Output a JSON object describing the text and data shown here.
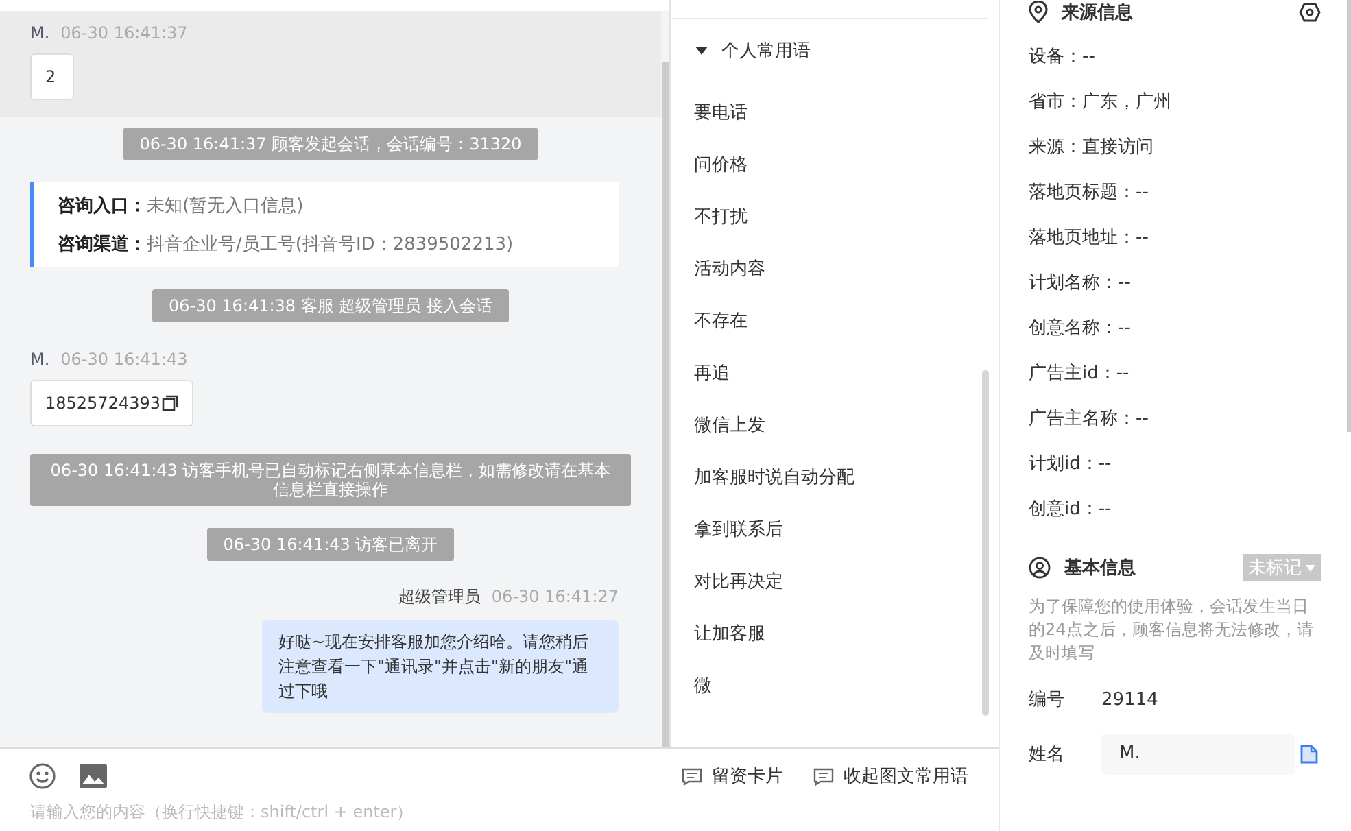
{
  "chat": {
    "messages": [
      {
        "kind": "customer",
        "name": "M.",
        "time": "06-30 16:41:37",
        "text": "2",
        "highlighted": true,
        "copyable": false
      },
      {
        "kind": "system",
        "text": "06-30 16:41:37 顾客发起会话，会话编号：31320"
      },
      {
        "kind": "info",
        "lines": [
          {
            "label": "咨询入口：",
            "value": "未知(暂无入口信息)"
          },
          {
            "label": "咨询渠道：",
            "value": "抖音企业号/员工号(抖音号ID：2839502213)"
          }
        ]
      },
      {
        "kind": "system",
        "text": "06-30 16:41:38 客服 超级管理员 接入会话"
      },
      {
        "kind": "customer",
        "name": "M.",
        "time": "06-30 16:41:43",
        "text": "18525724393",
        "highlighted": false,
        "copyable": true
      },
      {
        "kind": "system",
        "text": "06-30 16:41:43 访客手机号已自动标记右侧基本信息栏，如需修改请在基本信息栏直接操作"
      },
      {
        "kind": "system",
        "text": "06-30 16:41:43 访客已离开"
      },
      {
        "kind": "agent",
        "name": "超级管理员",
        "time": "06-30 16:41:27",
        "text": "好哒~现在安排客服加您介绍哈。请您稍后注意查看一下\"通讯录\"并点击\"新的朋友\"通过下哦"
      }
    ]
  },
  "phrases": {
    "group": {
      "label": "个人常用语",
      "expanded": true
    },
    "items": [
      "要电话",
      "问价格",
      "不打扰",
      "活动内容",
      "不存在",
      "再追",
      "微信上发",
      "加客服时说自动分配",
      "拿到联系后",
      "对比再决定",
      "让加客服",
      "微"
    ]
  },
  "composer": {
    "placeholder": "请输入您的内容（换行快捷键：shift/ctrl + enter）",
    "buttons": [
      "留资卡片",
      "收起图文常用语"
    ]
  },
  "source_info": {
    "title": "来源信息",
    "lines": [
      "设备：--",
      "省市：广东，广州",
      "来源：直接访问",
      "落地页标题：--",
      "落地页地址：--",
      "计划名称：--",
      "创意名称：--",
      "广告主id：--",
      "广告主名称：--",
      "计划id：--",
      "创意id：--"
    ]
  },
  "basic_info": {
    "title": "基本信息",
    "tag": "未标记",
    "notice": "为了保障您的使用体验，会话发生当日的24点之后，顾客信息将无法修改，请及时填写",
    "fields": [
      {
        "kind": "text",
        "label": "编号",
        "value": "29114"
      },
      {
        "kind": "input",
        "label": "姓名",
        "value": "M."
      }
    ]
  }
}
